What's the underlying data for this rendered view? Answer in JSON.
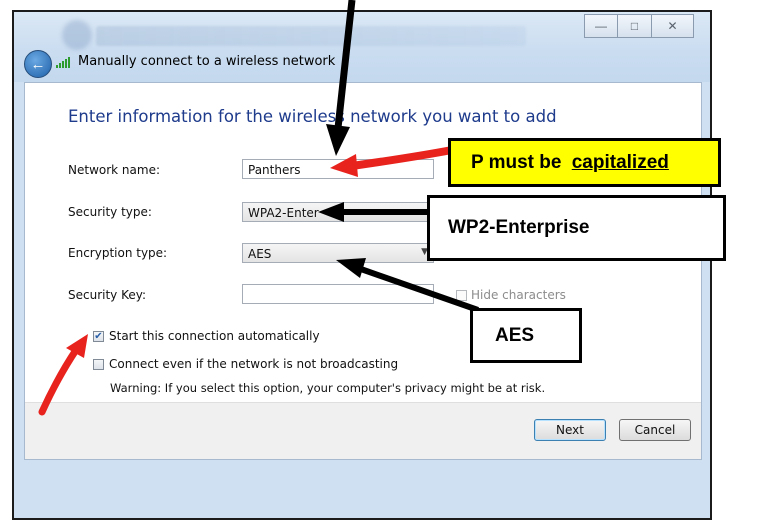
{
  "window": {
    "caption": "Manually connect to a wireless network",
    "controls": {
      "minimize": "—",
      "maximize": "□",
      "close": "✕"
    }
  },
  "form": {
    "heading": "Enter information for the wireless network you want to add",
    "network_name_label": "Network name:",
    "network_name_value": "Panthers",
    "security_type_label": "Security type:",
    "security_type_value": "WPA2-Enter",
    "encryption_type_label": "Encryption type:",
    "encryption_type_value": "AES",
    "security_key_label": "Security Key:",
    "security_key_value": "",
    "hide_characters_label": "Hide characters",
    "hide_characters_checked": false,
    "start_auto_label": "Start this connection automatically",
    "start_auto_checked": true,
    "connect_hidden_label": "Connect even if the network is not broadcasting",
    "connect_hidden_checked": false,
    "warning": "Warning: If you select this option, your computer's privacy might be at risk."
  },
  "buttons": {
    "next": "Next",
    "cancel": "Cancel"
  },
  "annotations": {
    "callout_name_prefix": "P must be ",
    "callout_name_emph": "capitalized",
    "callout_security": "WP2-Enterprise",
    "callout_encryption": "AES",
    "colors": {
      "callout_yellow": "#ffff00",
      "arrow_red": "#e8231e",
      "arrow_black": "#000000"
    }
  },
  "icons": [
    "back-arrow-icon",
    "wireless-signal-icon",
    "minimize-icon",
    "maximize-icon",
    "close-icon",
    "checkmark-icon",
    "dropdown-arrow-icon"
  ]
}
